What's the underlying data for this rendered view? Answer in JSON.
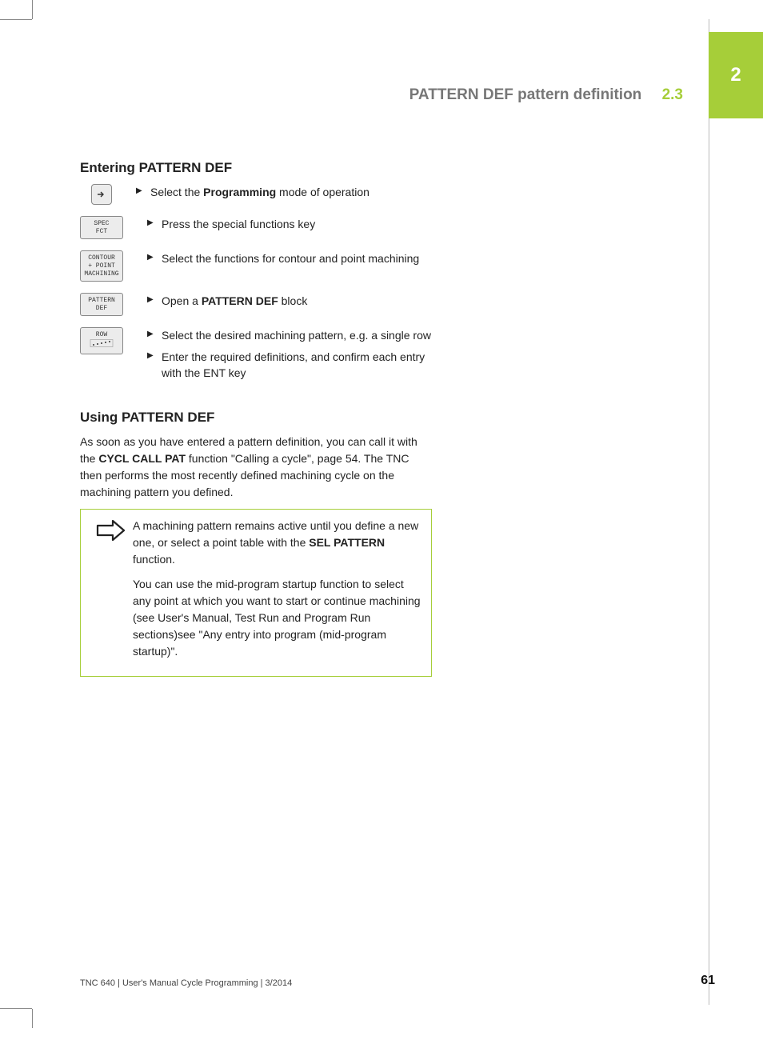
{
  "chapter_tab": "2",
  "running_head": {
    "title": "PATTERN DEF pattern definition",
    "section": "2.3"
  },
  "section1": {
    "heading": "Entering PATTERN DEF",
    "keys": {
      "spec_fct": "SPEC\nFCT",
      "contour": "CONTOUR\n+ POINT\nMACHINING",
      "pattern": "PATTERN\nDEF",
      "row": "ROW"
    },
    "steps": {
      "s1_pre": "Select the ",
      "s1_bold": "Programming",
      "s1_post": " mode of operation",
      "s2": "Press the special functions key",
      "s3": "Select the functions for contour and point machining",
      "s4_pre": "Open a ",
      "s4_bold": "PATTERN DEF",
      "s4_post": " block",
      "s5": "Select the desired machining pattern, e.g. a single row",
      "s6": "Enter the required definitions, and confirm each entry with the ENT key"
    }
  },
  "section2": {
    "heading": "Using PATTERN DEF",
    "p1_pre": "As soon as you have entered a pattern definition, you can call it with the ",
    "p1_bold": "CYCL CALL PAT",
    "p1_post": " function \"Calling a cycle\", page 54. The TNC then performs the most recently defined machining cycle on the machining pattern you defined.",
    "note_p1_pre": "A machining pattern remains active until you define a new one, or select a point table with the ",
    "note_p1_bold": "SEL PATTERN",
    "note_p1_post": " function.",
    "note_p2": "You can use the mid-program startup function to select any point at which you want to start or continue machining (see User's Manual, Test Run and Program Run sections)see \"Any entry into program (mid-program startup)\"."
  },
  "footer": {
    "left": "TNC 640 | User's Manual Cycle Programming | 3/2014",
    "page": "61"
  }
}
